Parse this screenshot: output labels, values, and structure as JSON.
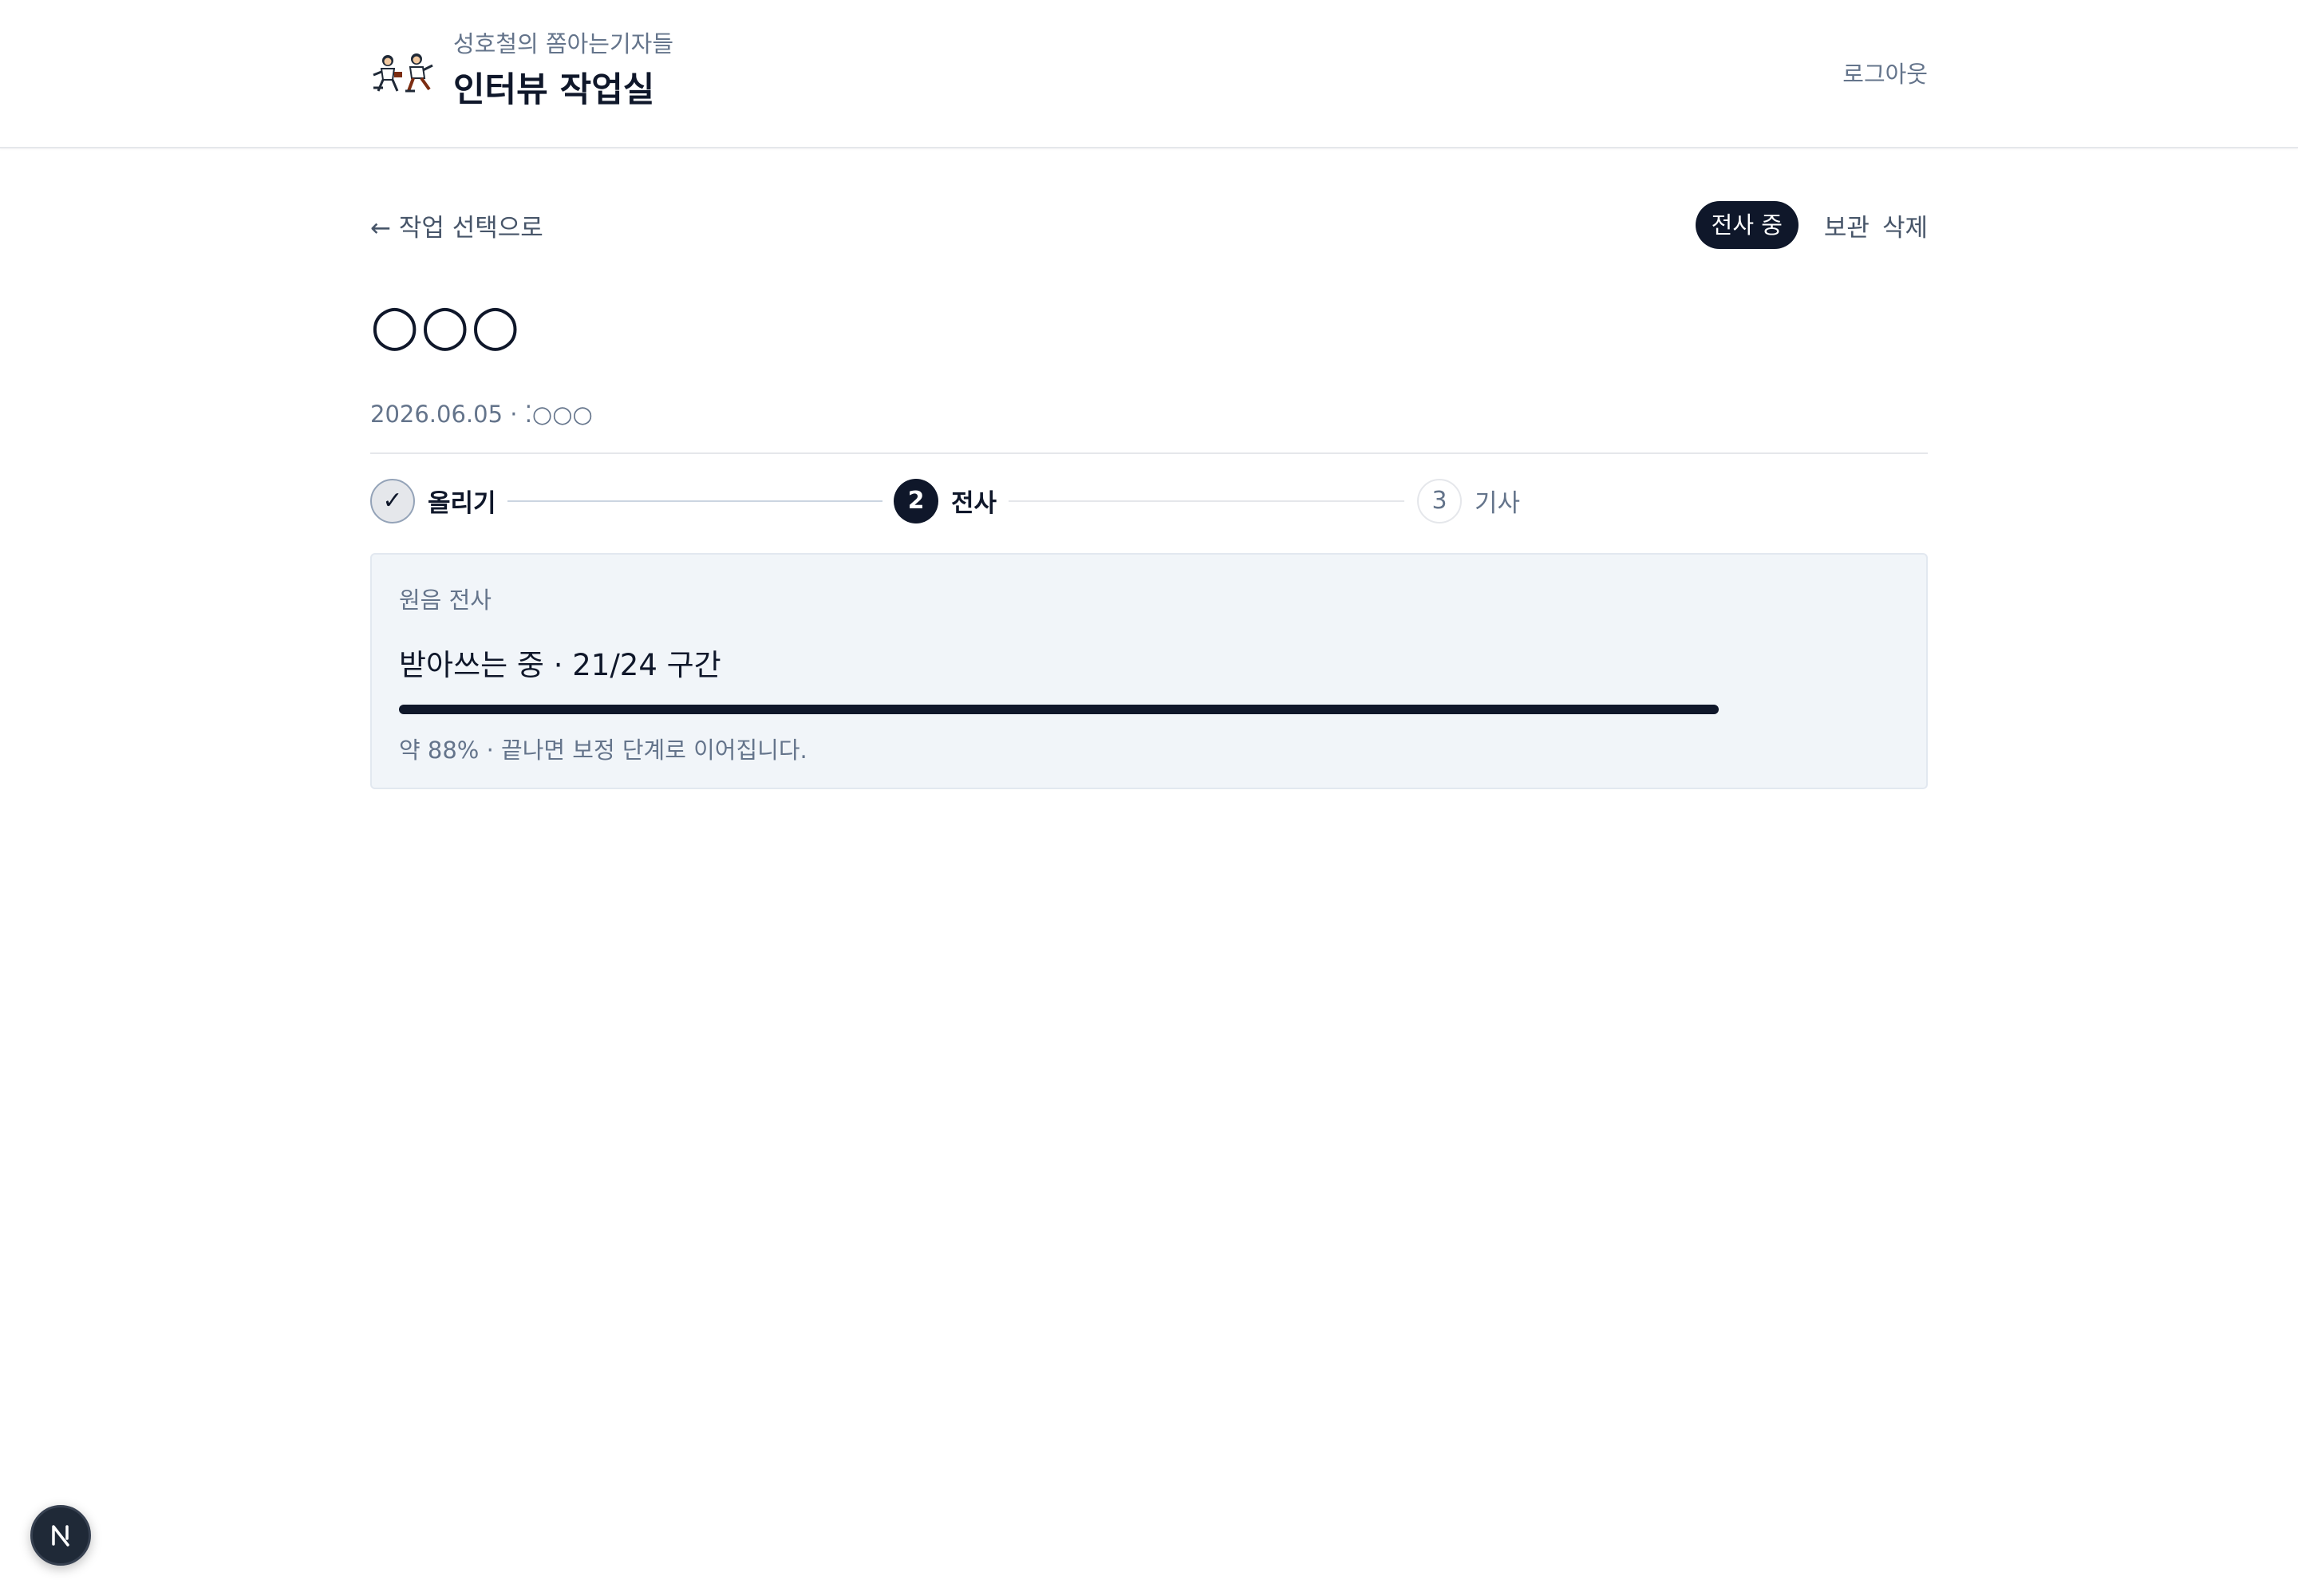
{
  "header": {
    "brand_subtitle": "성호철의 쫌아는기자들",
    "brand_title": "인터뷰 작업실",
    "logout_label": "로그아웃",
    "logo_icon": "reporters-logo-icon"
  },
  "toolbar": {
    "back_label": "← 작업 선택으로",
    "status_pill": "전사 중",
    "archive_label": "보관",
    "delete_label": "삭제"
  },
  "interview": {
    "title": "○○○",
    "meta": "2026.06.05 · ⁚○○○"
  },
  "stepper": {
    "steps": [
      {
        "marker": "✓",
        "label": "올리기",
        "state": "done"
      },
      {
        "marker": "2",
        "label": "전사",
        "state": "active"
      },
      {
        "marker": "3",
        "label": "기사",
        "state": "todo"
      }
    ]
  },
  "transcription": {
    "section_label": "원음 전사",
    "status_text": "받아쓰는 중 · 21/24 구간",
    "progress_fraction": 0.88,
    "note": "약 88% · 끝나면 보정 단계로 이어집니다."
  },
  "floating": {
    "icon": "nextjs-n-icon"
  },
  "colors": {
    "primary": "#0f172a",
    "muted_text": "#64748b",
    "card_background": "#f1f5f9",
    "border": "#e5e7eb"
  }
}
